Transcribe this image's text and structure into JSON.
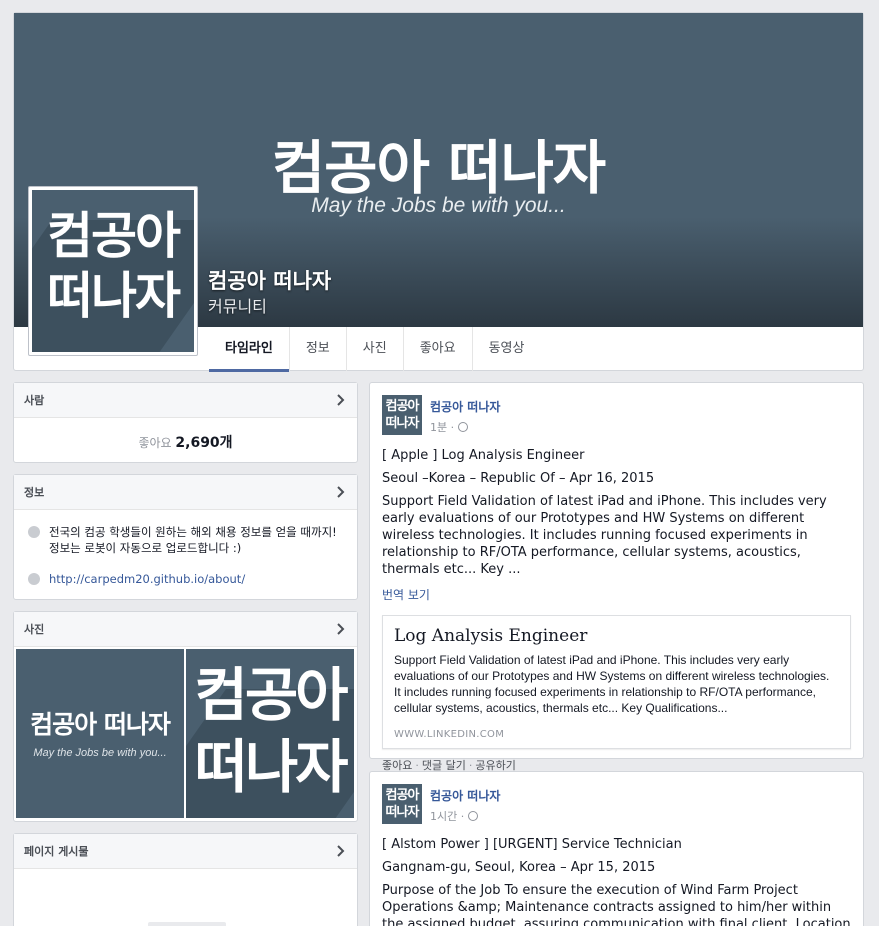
{
  "page": {
    "name": "컴공아 떠나자",
    "category": "커뮤니티",
    "cover_title": "컴공아 떠나자",
    "cover_subtitle": "May the Jobs be with you...",
    "profile_line1": "컴공아",
    "profile_line2": "떠나자",
    "colors": {
      "brand": "#4a5f6f",
      "link": "#365899",
      "tab_active": "#4e69a2"
    }
  },
  "tabs": [
    {
      "label": "타임라인",
      "active": true
    },
    {
      "label": "정보"
    },
    {
      "label": "사진"
    },
    {
      "label": "좋아요"
    },
    {
      "label": "동영상"
    }
  ],
  "sidebar": {
    "people": {
      "title": "사람",
      "likes_label": "좋아요",
      "likes_count": "2,690개"
    },
    "about": {
      "title": "정보",
      "description": "전국의 컴공 학생들이 원하는 해외 채용 정보를 얻을 때까지! 정보는 로봇이 자동으로 업로드합니다 :)",
      "url": "http://carpedm20.github.io/about/"
    },
    "photos": {
      "title": "사진",
      "photo1_title": "컴공아 떠나자",
      "photo1_subtitle": "May the Jobs be with you...",
      "photo2_line1": "컴공아",
      "photo2_line2": "떠나자"
    },
    "page_posts": {
      "title": "페이지 게시물"
    }
  },
  "posts": [
    {
      "avatar_line1": "컴공아",
      "avatar_line2": "떠나자",
      "author": "컴공아 떠나자",
      "time": "1분 ·",
      "title": "[ Apple ] Log Analysis Engineer",
      "location": "Seoul –Korea – Republic Of – Apr 16, 2015",
      "body": "Support Field Validation of latest iPad and iPhone. This includes very early evaluations of our Prototypes and HW Systems on different wireless technologies. It includes running focused experiments in relationship to RF/OTA performance, cellular systems, acoustics, thermals etc... Key ...",
      "translate": "번역 보기",
      "link_title": "Log Analysis Engineer",
      "link_desc": "Support Field Validation of latest iPad and iPhone. This includes very early evaluations of our Prototypes and HW Systems on different wireless technologies. It includes running focused experiments in relationship to RF/OTA performance, cellular systems, acoustics, thermals etc... Key Qualifications...",
      "link_domain": "WWW.LINKEDIN.COM",
      "like": "좋아요",
      "comment": "댓글 달기",
      "share": "공유하기"
    },
    {
      "avatar_line1": "컴공아",
      "avatar_line2": "떠나자",
      "author": "컴공아 떠나자",
      "time": "1시간 ·",
      "title": "[ Alstom Power ] [URGENT] Service Technician",
      "location": "Gangnam-gu, Seoul, Korea – Apr 15, 2015",
      "body": "Purpose of the Job To ensure the execution of Wind Farm Project Operations &amp; Maintenance contracts assigned to him/her within the assigned budget, assuring communication with final client. Location"
    }
  ]
}
